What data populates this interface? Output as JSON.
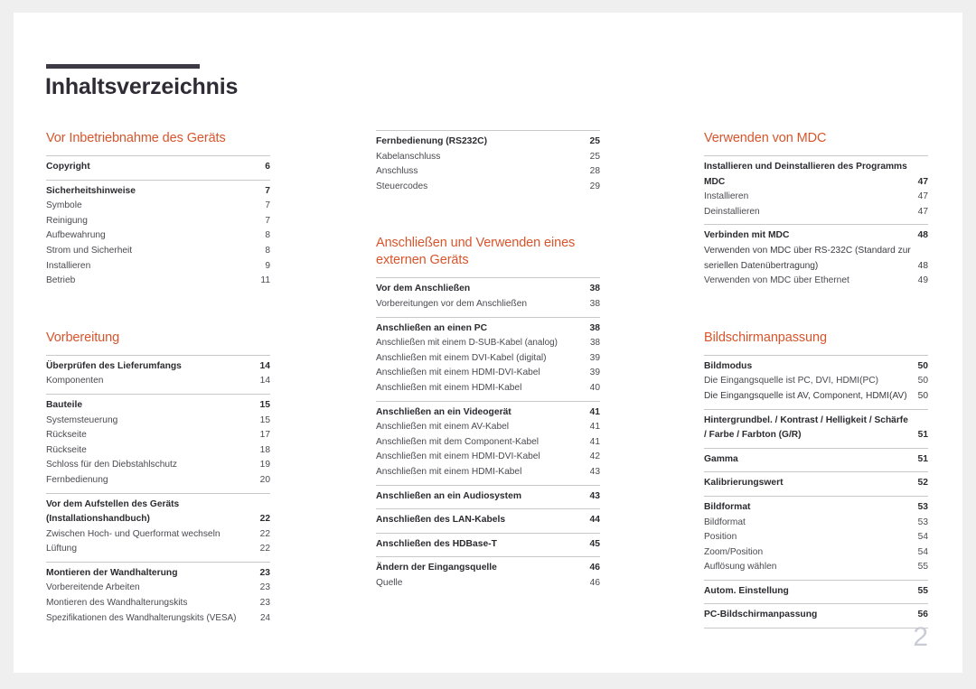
{
  "document": {
    "title": "Inhaltsverzeichnis",
    "folio": "2"
  },
  "colors": {
    "accent": "#d8552c",
    "title": "#2f2c35",
    "rule": "#c9c9c9",
    "title_bar": "#3d3a45",
    "folio": "#c9ccd4",
    "page_bg": "#ffffff",
    "canvas_bg": "#efeff0"
  },
  "columns": [
    {
      "id": "column-1",
      "sections": [
        {
          "heading": "Vor Inbetriebnahme des Geräts",
          "groups": [
            {
              "entries": [
                {
                  "label": "Copyright",
                  "page": "6",
                  "level": "major"
                }
              ]
            },
            {
              "entries": [
                {
                  "label": "Sicherheitshinweise",
                  "page": "7",
                  "level": "major"
                },
                {
                  "label": "Symbole",
                  "page": "7",
                  "level": "minor"
                },
                {
                  "label": "Reinigung",
                  "page": "7",
                  "level": "minor"
                },
                {
                  "label": "Aufbewahrung",
                  "page": "8",
                  "level": "minor"
                },
                {
                  "label": "Strom und Sicherheit",
                  "page": "8",
                  "level": "minor"
                },
                {
                  "label": "Installieren",
                  "page": "9",
                  "level": "minor"
                },
                {
                  "label": "Betrieb",
                  "page": "11",
                  "level": "minor"
                }
              ]
            }
          ]
        },
        {
          "heading": "Vorbereitung",
          "groups": [
            {
              "entries": [
                {
                  "label": "Überprüfen des Lieferumfangs",
                  "page": "14",
                  "level": "major"
                },
                {
                  "label": "Komponenten",
                  "page": "14",
                  "level": "minor"
                }
              ]
            },
            {
              "entries": [
                {
                  "label": "Bauteile",
                  "page": "15",
                  "level": "major"
                },
                {
                  "label": "Systemsteuerung",
                  "page": "15",
                  "level": "minor"
                },
                {
                  "label": "Rückseite",
                  "page": "17",
                  "level": "minor"
                },
                {
                  "label": "Rückseite",
                  "page": "18",
                  "level": "minor"
                },
                {
                  "label": "Schloss für den Diebstahlschutz",
                  "page": "19",
                  "level": "minor"
                },
                {
                  "label": "Fernbedienung",
                  "page": "20",
                  "level": "minor"
                }
              ]
            },
            {
              "entries": [
                {
                  "label": "Vor dem Aufstellen des Geräts (Installationshandbuch)",
                  "page": "22",
                  "level": "major",
                  "multiline": true
                },
                {
                  "label": "Zwischen Hoch- und Querformat wechseln",
                  "page": "22",
                  "level": "minor"
                },
                {
                  "label": "Lüftung",
                  "page": "22",
                  "level": "minor"
                }
              ]
            },
            {
              "entries": [
                {
                  "label": "Montieren der Wandhalterung",
                  "page": "23",
                  "level": "major"
                },
                {
                  "label": "Vorbereitende Arbeiten",
                  "page": "23",
                  "level": "minor"
                },
                {
                  "label": "Montieren des Wandhalterungskits",
                  "page": "23",
                  "level": "minor"
                },
                {
                  "label": "Spezifikationen des Wandhalterungskits (VESA)",
                  "page": "24",
                  "level": "minor",
                  "tight": true
                }
              ]
            }
          ]
        }
      ]
    },
    {
      "id": "column-2",
      "sections": [
        {
          "heading": "",
          "groups": [
            {
              "entries": [
                {
                  "label": "Fernbedienung (RS232C)",
                  "page": "25",
                  "level": "major"
                },
                {
                  "label": "Kabelanschluss",
                  "page": "25",
                  "level": "minor"
                },
                {
                  "label": "Anschluss",
                  "page": "28",
                  "level": "minor"
                },
                {
                  "label": "Steuercodes",
                  "page": "29",
                  "level": "minor"
                }
              ]
            }
          ]
        },
        {
          "heading": "Anschließen und Verwenden eines externen Geräts",
          "groups": [
            {
              "entries": [
                {
                  "label": "Vor dem Anschließen",
                  "page": "38",
                  "level": "major"
                },
                {
                  "label": "Vorbereitungen vor dem Anschließen",
                  "page": "38",
                  "level": "minor"
                }
              ]
            },
            {
              "entries": [
                {
                  "label": "Anschließen an einen PC",
                  "page": "38",
                  "level": "major"
                },
                {
                  "label": "Anschließen mit einem D-SUB-Kabel (analog)",
                  "page": "38",
                  "level": "minor",
                  "tight": true
                },
                {
                  "label": "Anschließen mit einem DVI-Kabel (digital)",
                  "page": "39",
                  "level": "minor"
                },
                {
                  "label": "Anschließen mit einem HDMI-DVI-Kabel",
                  "page": "39",
                  "level": "minor"
                },
                {
                  "label": "Anschließen mit einem HDMI-Kabel",
                  "page": "40",
                  "level": "minor"
                }
              ]
            },
            {
              "entries": [
                {
                  "label": "Anschließen an ein Videogerät",
                  "page": "41",
                  "level": "major"
                },
                {
                  "label": "Anschließen mit einem AV-Kabel",
                  "page": "41",
                  "level": "minor"
                },
                {
                  "label": "Anschließen mit dem Component-Kabel",
                  "page": "41",
                  "level": "minor"
                },
                {
                  "label": "Anschließen mit einem HDMI-DVI-Kabel",
                  "page": "42",
                  "level": "minor"
                },
                {
                  "label": "Anschließen mit einem HDMI-Kabel",
                  "page": "43",
                  "level": "minor"
                }
              ]
            },
            {
              "entries": [
                {
                  "label": "Anschließen an ein Audiosystem",
                  "page": "43",
                  "level": "major"
                }
              ]
            },
            {
              "entries": [
                {
                  "label": "Anschließen des LAN-Kabels",
                  "page": "44",
                  "level": "major"
                }
              ]
            },
            {
              "entries": [
                {
                  "label": "Anschließen des HDBase-T",
                  "page": "45",
                  "level": "major"
                }
              ]
            },
            {
              "entries": [
                {
                  "label": "Ändern der Eingangsquelle",
                  "page": "46",
                  "level": "major"
                },
                {
                  "label": "Quelle",
                  "page": "46",
                  "level": "minor"
                }
              ]
            }
          ]
        }
      ]
    },
    {
      "id": "column-3",
      "sections": [
        {
          "heading": "Verwenden von MDC",
          "groups": [
            {
              "entries": [
                {
                  "label": "Installieren und Deinstallieren des Programms MDC",
                  "page": "47",
                  "level": "major",
                  "multiline": true
                },
                {
                  "label": "Installieren",
                  "page": "47",
                  "level": "minor"
                },
                {
                  "label": "Deinstallieren",
                  "page": "47",
                  "level": "minor"
                }
              ]
            },
            {
              "entries": [
                {
                  "label": "Verbinden mit MDC",
                  "page": "48",
                  "level": "major"
                },
                {
                  "label": "Verwenden von MDC über RS-232C (Standard zur seriellen Datenübertragung)",
                  "page": "48",
                  "level": "minor",
                  "multiline": true
                },
                {
                  "label": "Verwenden von MDC über Ethernet",
                  "page": "49",
                  "level": "minor"
                }
              ]
            }
          ]
        },
        {
          "heading": "Bildschirmanpassung",
          "groups": [
            {
              "entries": [
                {
                  "label": "Bildmodus",
                  "page": "50",
                  "level": "major"
                },
                {
                  "label": "Die Eingangsquelle ist PC, DVI, HDMI(PC)",
                  "page": "50",
                  "level": "minor"
                },
                {
                  "label": "Die Eingangsquelle ist AV, Component, HDMI(AV)",
                  "page": "50",
                  "level": "minor",
                  "multiline": true
                }
              ]
            },
            {
              "entries": [
                {
                  "label": "Hintergrundbel. / Kontrast / Helligkeit / Schärfe / Farbe / Farbton (G/R)",
                  "page": "51",
                  "level": "major",
                  "multiline": true
                }
              ]
            },
            {
              "entries": [
                {
                  "label": "Gamma",
                  "page": "51",
                  "level": "major"
                }
              ]
            },
            {
              "entries": [
                {
                  "label": "Kalibrierungswert",
                  "page": "52",
                  "level": "major"
                }
              ]
            },
            {
              "entries": [
                {
                  "label": "Bildformat",
                  "page": "53",
                  "level": "major"
                },
                {
                  "label": "Bildformat",
                  "page": "53",
                  "level": "minor"
                },
                {
                  "label": "Position",
                  "page": "54",
                  "level": "minor"
                },
                {
                  "label": "Zoom/Position",
                  "page": "54",
                  "level": "minor"
                },
                {
                  "label": "Auflösung wählen",
                  "page": "55",
                  "level": "minor"
                }
              ]
            },
            {
              "entries": [
                {
                  "label": "Autom. Einstellung",
                  "page": "55",
                  "level": "major"
                }
              ]
            },
            {
              "entries": [
                {
                  "label": "PC-Bildschirmanpassung",
                  "page": "56",
                  "level": "major",
                  "lastGroup": true
                }
              ]
            }
          ]
        }
      ]
    }
  ]
}
